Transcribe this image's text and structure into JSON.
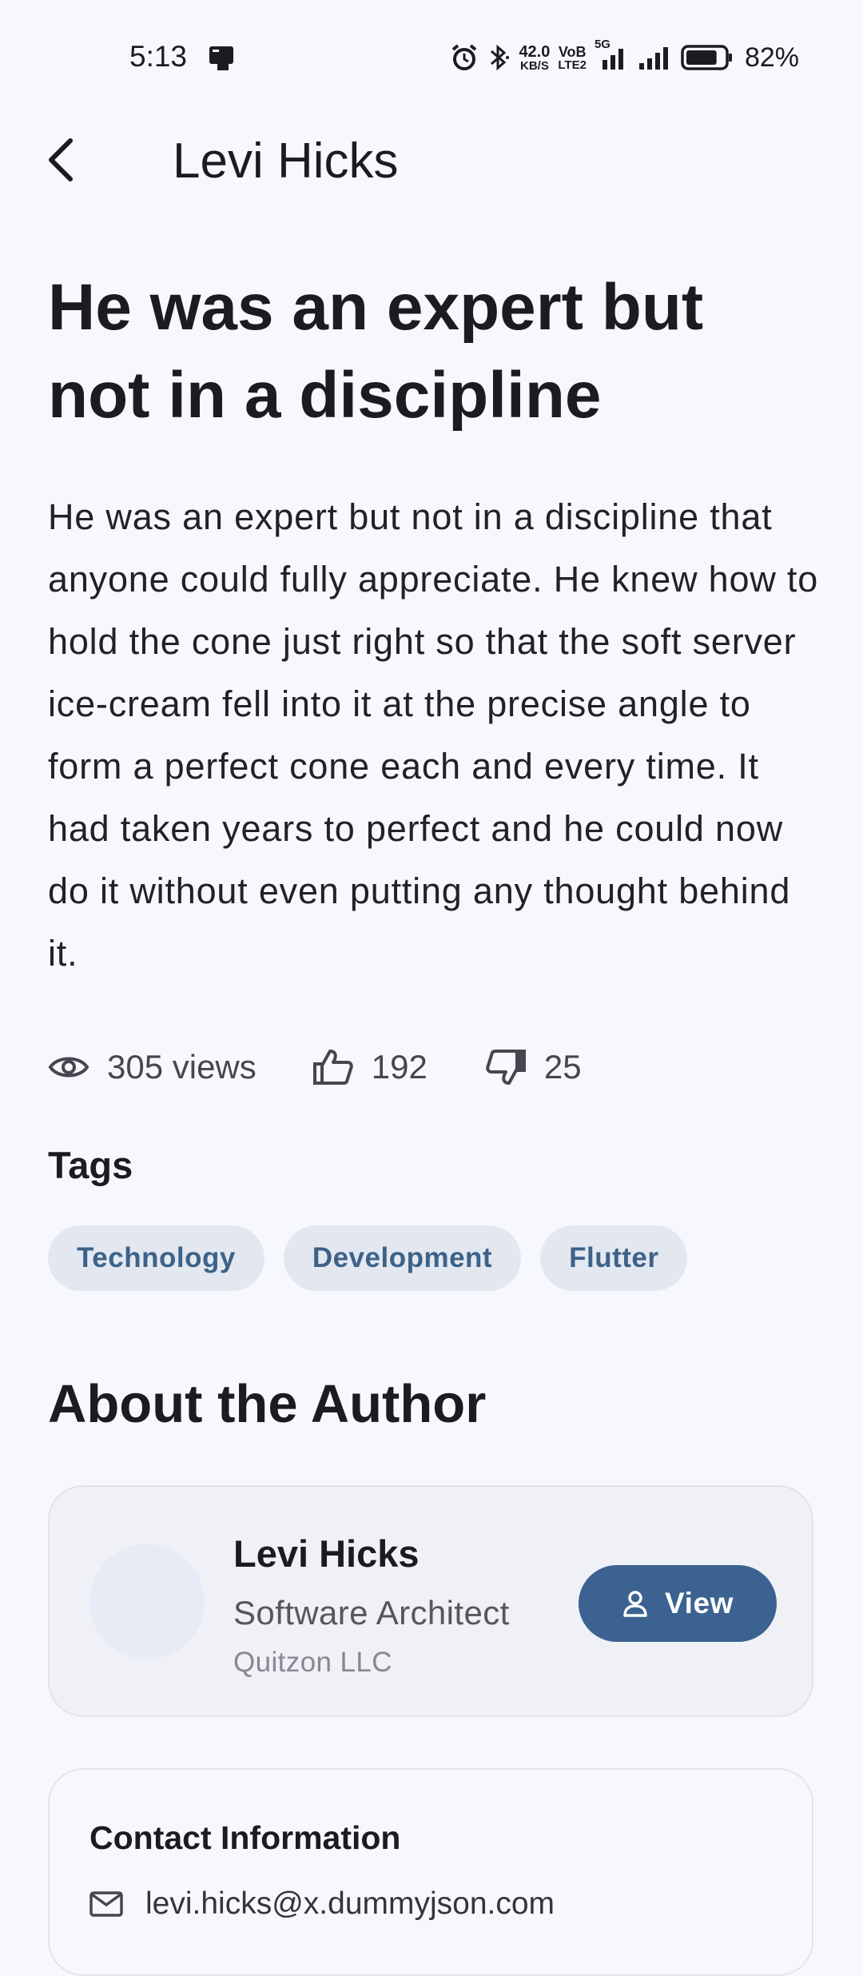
{
  "status_bar": {
    "time": "5:13",
    "net_speed_value": "42.0",
    "net_speed_unit": "KB/S",
    "volte_top": "VoB",
    "volte_bottom": "LTE2",
    "network_type": "5G",
    "battery_percent": "82%",
    "battery_level": 0.82
  },
  "app_bar": {
    "title": "Levi Hicks",
    "back_icon": "arrow-back-icon"
  },
  "article": {
    "headline": "He was an expert but not in a discipline",
    "body": "He was an expert but not in a discipline that anyone could fully appreciate. He knew how to hold the cone just right so that the soft server ice-cream fell into it at the precise angle to form a perfect cone each and every time. It had taken years to perfect and he could now do it without even putting any thought behind it.",
    "stats": {
      "views": "305 views",
      "likes": "192",
      "dislikes": "25"
    }
  },
  "tags": {
    "title": "Tags",
    "items": [
      "Technology",
      "Development",
      "Flutter"
    ]
  },
  "author": {
    "section_title": "About the Author",
    "name": "Levi Hicks",
    "role": "Software Architect",
    "company": "Quitzon LLC",
    "view_label": "View"
  },
  "contact": {
    "title": "Contact Information",
    "email": "levi.hicks@x.dummyjson.com"
  },
  "colors": {
    "background": "#f7f8fd",
    "accent": "#3b6290",
    "tag_bg": "#e3e7f0",
    "tag_text": "#3c6289"
  }
}
